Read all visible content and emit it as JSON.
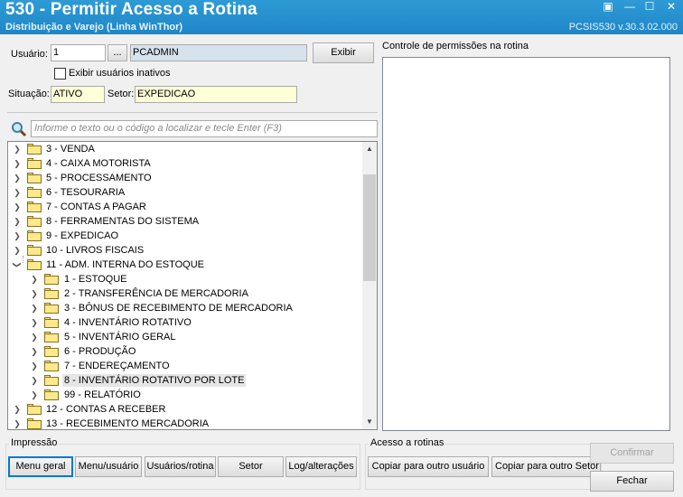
{
  "window": {
    "title": "530 - Permitir Acesso a Rotina",
    "subtitle": "Distribuição e Varejo (Linha WinThor)",
    "version": "PCSIS530  v.30.3.02.000"
  },
  "form": {
    "usuario_label": "Usuário:",
    "usuario_code": "1",
    "usuario_lookup": "...",
    "usuario_name": "PCADMIN",
    "exibir_button": "Exibir",
    "inativos_label": "Exibir usuários inativos",
    "inativos_checked": false,
    "situacao_label": "Situação:",
    "situacao_value": "ATIVO",
    "setor_label": "Setor:",
    "setor_value": "EXPEDICAO",
    "search_placeholder": "Informe o texto ou o código a localizar e tecle Enter (F3)"
  },
  "tree": {
    "items": [
      {
        "label": "3 - VENDA",
        "level": 0,
        "expanded": false
      },
      {
        "label": "4 - CAIXA MOTORISTA",
        "level": 0,
        "expanded": false
      },
      {
        "label": "5 - PROCESSAMENTO",
        "level": 0,
        "expanded": false
      },
      {
        "label": "6 - TESOURARIA",
        "level": 0,
        "expanded": false
      },
      {
        "label": "7 - CONTAS A PAGAR",
        "level": 0,
        "expanded": false
      },
      {
        "label": "8 - FERRAMENTAS DO SISTEMA",
        "level": 0,
        "expanded": false
      },
      {
        "label": "9 - EXPEDICAO",
        "level": 0,
        "expanded": false
      },
      {
        "label": "10 - LIVROS FISCAIS",
        "level": 0,
        "expanded": false
      },
      {
        "label": "11 - ADM. INTERNA DO ESTOQUE",
        "level": 0,
        "expanded": true
      },
      {
        "label": "1 - ESTOQUE",
        "level": 1,
        "expanded": false
      },
      {
        "label": "2 - TRANSFERÊNCIA DE MERCADORIA",
        "level": 1,
        "expanded": false
      },
      {
        "label": "3 - BÔNUS DE RECEBIMENTO DE MERCADORIA",
        "level": 1,
        "expanded": false
      },
      {
        "label": "4 - INVENTÁRIO ROTATIVO",
        "level": 1,
        "expanded": false
      },
      {
        "label": "5 - INVENTÁRIO GERAL",
        "level": 1,
        "expanded": false
      },
      {
        "label": "6 - PRODUÇÃO",
        "level": 1,
        "expanded": false
      },
      {
        "label": "7 - ENDEREÇAMENTO",
        "level": 1,
        "expanded": false
      },
      {
        "label": "8 - INVENTÁRIO ROTATIVO POR LOTE",
        "level": 1,
        "expanded": false,
        "selected": true
      },
      {
        "label": "99 - RELATÓRIO",
        "level": 1,
        "expanded": false
      },
      {
        "label": "12 - CONTAS A RECEBER",
        "level": 0,
        "expanded": false
      },
      {
        "label": "13 - RECEBIMENTO MERCADORIA",
        "level": 0,
        "expanded": false
      }
    ]
  },
  "permissions_panel": {
    "title": "Controle de permissões na rotina"
  },
  "impressao": {
    "title": "Impressão",
    "buttons": [
      "Menu geral",
      "Menu/usuário",
      "Usuários/rotina",
      "Setor",
      "Log/alterações"
    ]
  },
  "acesso": {
    "title": "Acesso a rotinas",
    "buttons": [
      "Copiar para outro usuário",
      "Copiar para outro Setor"
    ]
  },
  "actions": {
    "confirmar": "Confirmar",
    "fechar": "Fechar"
  }
}
